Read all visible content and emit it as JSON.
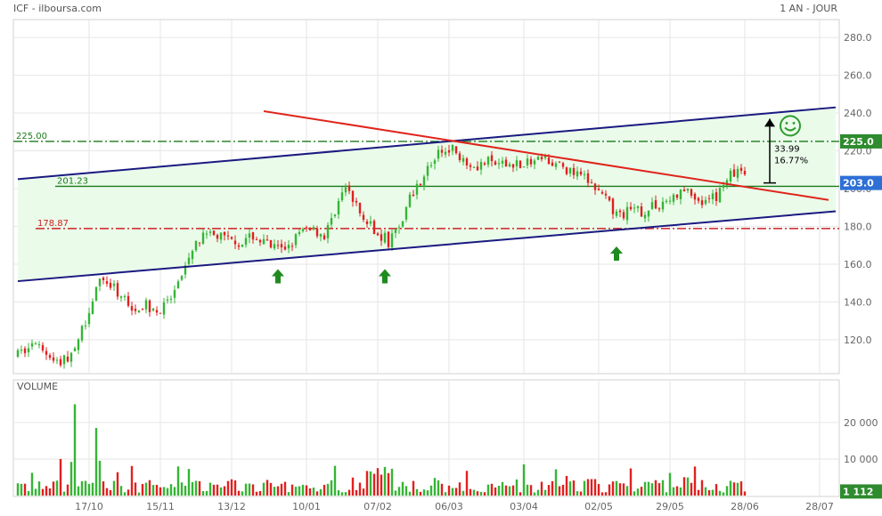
{
  "header": {
    "symbol_source": "ICF - ilboursa.com",
    "period": "1 AN - JOUR"
  },
  "chart_data": {
    "type": "candlestick",
    "price_axis": {
      "ylim": [
        103,
        289
      ],
      "ticks": [
        120,
        140,
        160,
        180,
        200,
        220,
        240,
        260,
        280
      ],
      "tick_labels": [
        "120.0",
        "140.0",
        "160.0",
        "180.0",
        "200.0",
        "220.0",
        "240.0",
        "260.0",
        "280.0"
      ]
    },
    "volume_axis": {
      "label": "VOLUME",
      "ylim": [
        0,
        29000
      ],
      "ticks": [
        10000,
        20000
      ],
      "tick_labels": [
        "10 000",
        "20 000"
      ]
    },
    "x_tick_labels": [
      "17/10",
      "15/11",
      "13/12",
      "10/01",
      "07/02",
      "06/03",
      "03/04",
      "02/05",
      "29/05",
      "28/06",
      "28/07"
    ],
    "n_slots": 230,
    "data_bars": 205,
    "levels": [
      {
        "value": 225.0,
        "label": "225.00",
        "color": "#1b7a1b",
        "style": "dashdot"
      },
      {
        "value": 201.23,
        "label": "201.23",
        "color": "#1b7a1b",
        "style": "solid"
      },
      {
        "value": 178.87,
        "label": "178.87",
        "color": "#cc2222",
        "style": "dashdot"
      }
    ],
    "trendlines": [
      {
        "name": "channel-upper",
        "color": "#1a1a80",
        "from": [
          0,
          205
        ],
        "to": [
          230,
          243
        ]
      },
      {
        "name": "channel-lower",
        "color": "#1a1a80",
        "from": [
          0,
          151
        ],
        "to": [
          230,
          188
        ]
      },
      {
        "name": "resistance",
        "color": "#e0241b",
        "from": [
          69,
          241
        ],
        "to": [
          228,
          194
        ]
      }
    ],
    "price_tags": [
      {
        "value": 225.0,
        "label": "225.0",
        "color": "#2e8b2e"
      },
      {
        "value": 203.0,
        "label": "203.0",
        "color": "#2e6fd6"
      }
    ],
    "volume_tag": {
      "value": 1112,
      "label": "1 112",
      "color": "#2e8b2e"
    },
    "target_annotation": {
      "from": 203,
      "to": 237,
      "distance": "33.99",
      "percent": "16.77%"
    },
    "arrows_up": [
      {
        "x": 73,
        "y": 164
      },
      {
        "x": 103,
        "y": 164
      },
      {
        "x": 168,
        "y": 176
      }
    ],
    "colors": {
      "up": "#35b535",
      "down": "#e02020",
      "channel_fill": "#eafbea",
      "grid": "#e6e6e6"
    }
  }
}
